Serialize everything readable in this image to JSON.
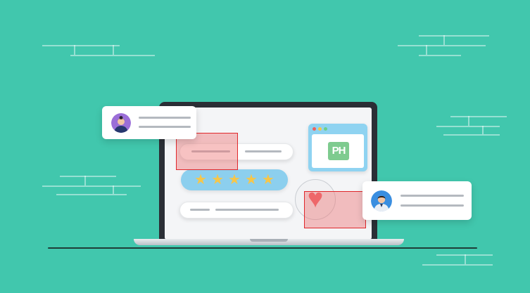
{
  "illustration": {
    "rating": {
      "stars": [
        "★",
        "★",
        "★",
        "★",
        "★"
      ],
      "value": 5,
      "max": 5
    },
    "ph_window": {
      "logo_text": "PH",
      "dot_colors": [
        "#f0625c",
        "#f6c64a",
        "#6fd08a"
      ]
    },
    "heart_icon": "♥",
    "colors": {
      "background": "#41c7ad",
      "stars_pill": "#8ccfee",
      "star": "#f6c64a",
      "heart": "#ef5a5f",
      "ph_logo": "#7ecb8f",
      "highlight_border": "#e0272b"
    }
  }
}
